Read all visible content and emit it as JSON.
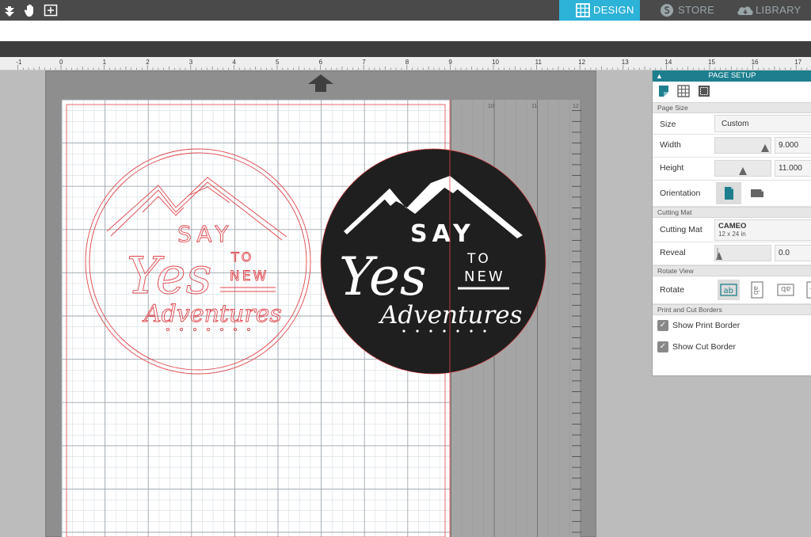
{
  "toolbar": {
    "icons": [
      "pan-down-icon",
      "hand-icon",
      "add-box-icon"
    ]
  },
  "tabs": [
    {
      "id": "design",
      "label": "DESIGN",
      "icon": "grid-icon",
      "active": true
    },
    {
      "id": "store",
      "label": "STORE",
      "icon": "store-icon",
      "active": false
    },
    {
      "id": "library",
      "label": "LIBRARY",
      "icon": "cloud-icon",
      "active": false
    }
  ],
  "colors": {
    "accent": "#2db2d8",
    "panel_header": "#1d7f8e",
    "cut_line": "#e0454b",
    "badge_fill": "#1f1f1f"
  },
  "ruler": {
    "labels": [
      "-1",
      "0",
      "1",
      "2",
      "3",
      "4",
      "5",
      "6",
      "7",
      "8",
      "9",
      "10",
      "11",
      "12",
      "13",
      "14",
      "15",
      "16",
      "17"
    ]
  },
  "mat": {
    "inner_labels": [
      "10",
      "11",
      "12"
    ]
  },
  "panel": {
    "title": "PAGE SETUP",
    "page_size": {
      "section": "Page Size",
      "size_label": "Size",
      "size_value": "Custom",
      "width_label": "Width",
      "width_value": "9.000",
      "height_label": "Height",
      "height_value": "11.000",
      "orientation_label": "Orientation"
    },
    "cutting_mat": {
      "section": "Cutting Mat",
      "label": "Cutting Mat",
      "value": "CAMEO",
      "sub": "12 x 24 in",
      "reveal_label": "Reveal",
      "reveal_value": "0.0"
    },
    "rotate_view": {
      "section": "Rotate View",
      "label": "Rotate",
      "options": [
        "ab",
        "ab",
        "ab",
        "ab"
      ]
    },
    "print_cut": {
      "section": "Print and Cut Borders",
      "show_print": "Show Print Border",
      "show_cut": "Show Cut Border"
    }
  },
  "design": {
    "line1": "SAY",
    "line2": "Yes",
    "line3": "TO",
    "line4": "NEW",
    "line5": "Adventures"
  }
}
